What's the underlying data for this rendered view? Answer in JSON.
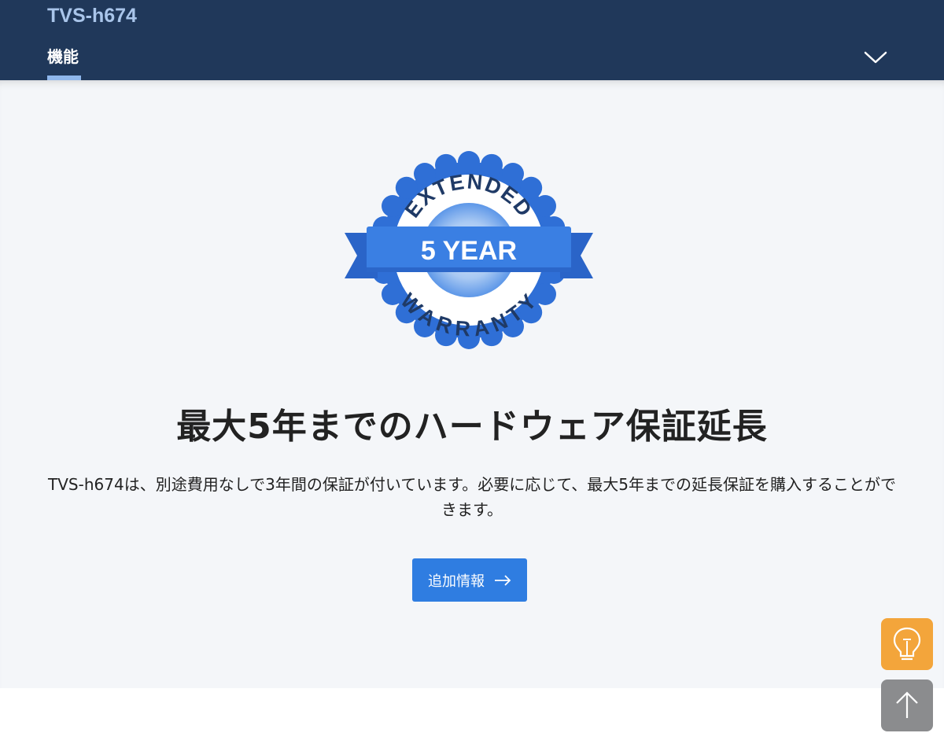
{
  "header": {
    "product_title": "TVS-h674",
    "tabs": [
      {
        "label": "機能",
        "active": true
      }
    ],
    "toggle_icon": "chevron-down-icon"
  },
  "badge": {
    "top_text": "EXTENDED",
    "ribbon_text": "5 YEAR",
    "bottom_text": "WARRANTY"
  },
  "main": {
    "headline": "最大5年までのハードウェア保証延長",
    "description": "TVS-h674は、別途費用なしで3年間の保証が付いています。必要に応じて、最大5年までの延長保証を購入することができます。",
    "button_label": "追加情報",
    "button_icon": "arrow-right-icon"
  },
  "floating": {
    "tips_icon": "lightbulb-icon",
    "back_to_top_icon": "arrow-up-icon"
  },
  "colors": {
    "nav_bg": "#20385a",
    "accent": "#2f7de1",
    "badge_blue": "#2f6fd6",
    "tips_orange": "#f3a53b",
    "back_top_gray": "#8b8c8e"
  }
}
